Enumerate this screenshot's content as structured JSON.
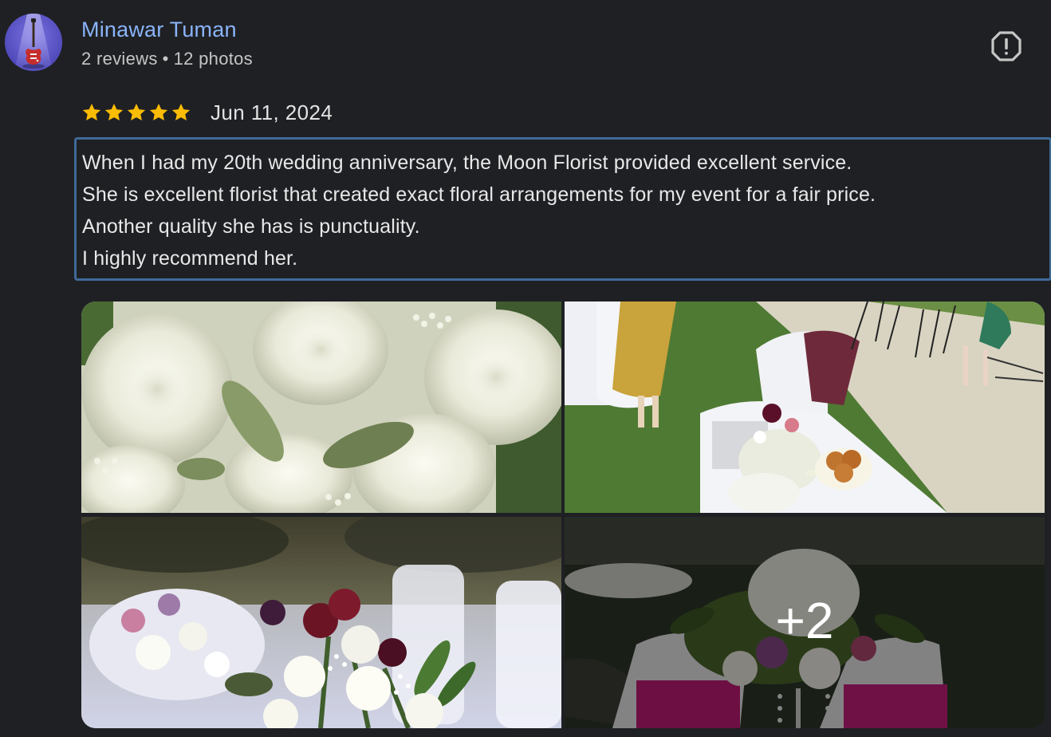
{
  "author": {
    "name": "Minawar Tuman",
    "reviews": "2 reviews",
    "separator": "•",
    "photos": "12 photos",
    "avatar_icon": "guitar-icon"
  },
  "report_icon": "report-icon",
  "rating": {
    "stars": 5,
    "max": 5,
    "date": "Jun 11, 2024",
    "star_color": "#fbbc04"
  },
  "review_text": [
    "When I had my 20th wedding anniversary, the Moon Florist provided excellent service.",
    "She is excellent florist that created exact floral arrangements for my event for a fair price.",
    "Another quality she has is punctuality.",
    "I highly recommend her."
  ],
  "photos": {
    "more_count": "+2"
  },
  "colors": {
    "background": "#1f2024",
    "name_link": "#8ab4f8",
    "focus_border": "#3f6a98"
  }
}
